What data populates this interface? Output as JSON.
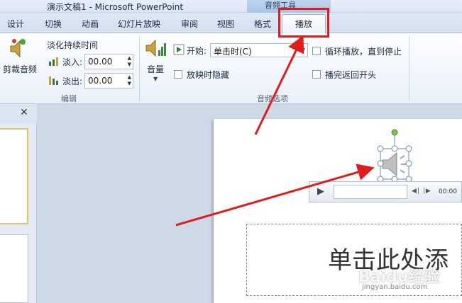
{
  "window": {
    "title": "演示文稿1 - Microsoft PowerPoint",
    "tool_group": "音频工具"
  },
  "tabs": {
    "design": "设计",
    "transitions": "切换",
    "animations": "动画",
    "slideshow": "幻灯片放映",
    "review": "审阅",
    "view": "视图",
    "format": "格式",
    "playback": "播放"
  },
  "ribbon": {
    "edit": {
      "trim_audio": "剪裁音频",
      "fade_duration": "淡化持续时间",
      "fade_in_label": "淡入:",
      "fade_in_value": "00.00",
      "fade_out_label": "淡出:",
      "fade_out_value": "00.00",
      "group_label": "编辑"
    },
    "audio_options": {
      "volume": "音量",
      "start_label": "开始:",
      "start_value": "单击时(C)",
      "hide_during_show": "放映时隐藏",
      "loop_until_stopped": "循环播放，直到停止",
      "rewind_after_playing": "播完返回开头",
      "group_label": "音频选项"
    }
  },
  "slide": {
    "title_placeholder": "单击此处添"
  },
  "player": {
    "time": "00:00"
  },
  "watermark": {
    "text": "Baidu经验",
    "sub": "jingyan.baidu.com"
  },
  "colors": {
    "annotation_red": "#e21b1b",
    "ribbon_bg": "#e9f0f9",
    "workspace_bg": "#ced9e8"
  }
}
